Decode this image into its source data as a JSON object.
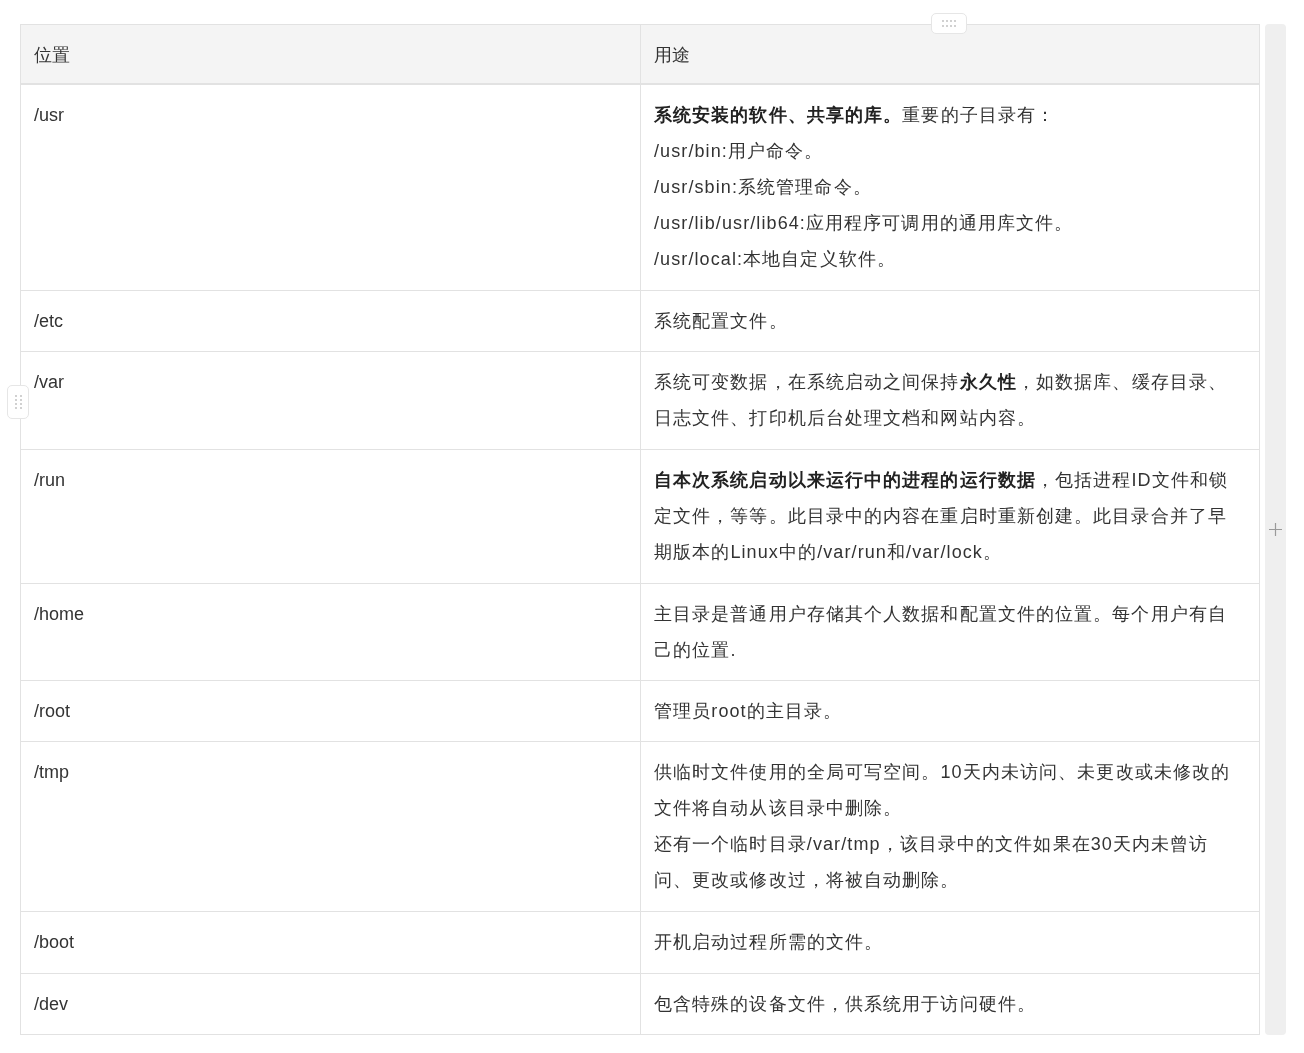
{
  "table": {
    "columns": [
      "位置",
      "用途"
    ],
    "rows": [
      {
        "location": "/usr",
        "description": [
          "**系统安装的软件、共享的库。**重要的子目录有：",
          "/usr/bin:用户命令。",
          "/usr/sbin:系统管理命令。",
          "/usr/lib/usr/lib64:应用程序可调用的通用库文件。",
          "/usr/local:本地自定义软件。"
        ]
      },
      {
        "location": "/etc",
        "description": [
          "系统配置文件。"
        ]
      },
      {
        "location": "/var",
        "description": [
          "系统可变数据，在系统启动之间保持**永久性**，如数据库、缓存目录、日志文件、打印机后台处理文档和网站内容。"
        ]
      },
      {
        "location": "/run",
        "description": [
          "**自本次系统启动以来运行中的进程的运行数据**，包括进程ID文件和锁定文件，等等。此目录中的内容在重启时重新创建。此目录合并了早期版本的Linux中的/var/run和/var/lock。"
        ]
      },
      {
        "location": "/home",
        "description": [
          "主目录是普通用户存储其个人数据和配置文件的位置。每个用户有自己的位置."
        ]
      },
      {
        "location": "/root",
        "description": [
          "管理员root的主目录。"
        ]
      },
      {
        "location": "/tmp",
        "description": [
          "供临时文件使用的全局可写空间。10天内未访问、未更改或未修改的文件将自动从该目录中删除。",
          "还有一个临时目录/var/tmp，该目录中的文件如果在30天内未曾访问、更改或修改过，将被自动删除。"
        ]
      },
      {
        "location": "/boot",
        "description": [
          "开机启动过程所需的文件。"
        ]
      },
      {
        "location": "/dev",
        "description": [
          "包含特殊的设备文件，供系统用于访问硬件。"
        ]
      }
    ]
  }
}
